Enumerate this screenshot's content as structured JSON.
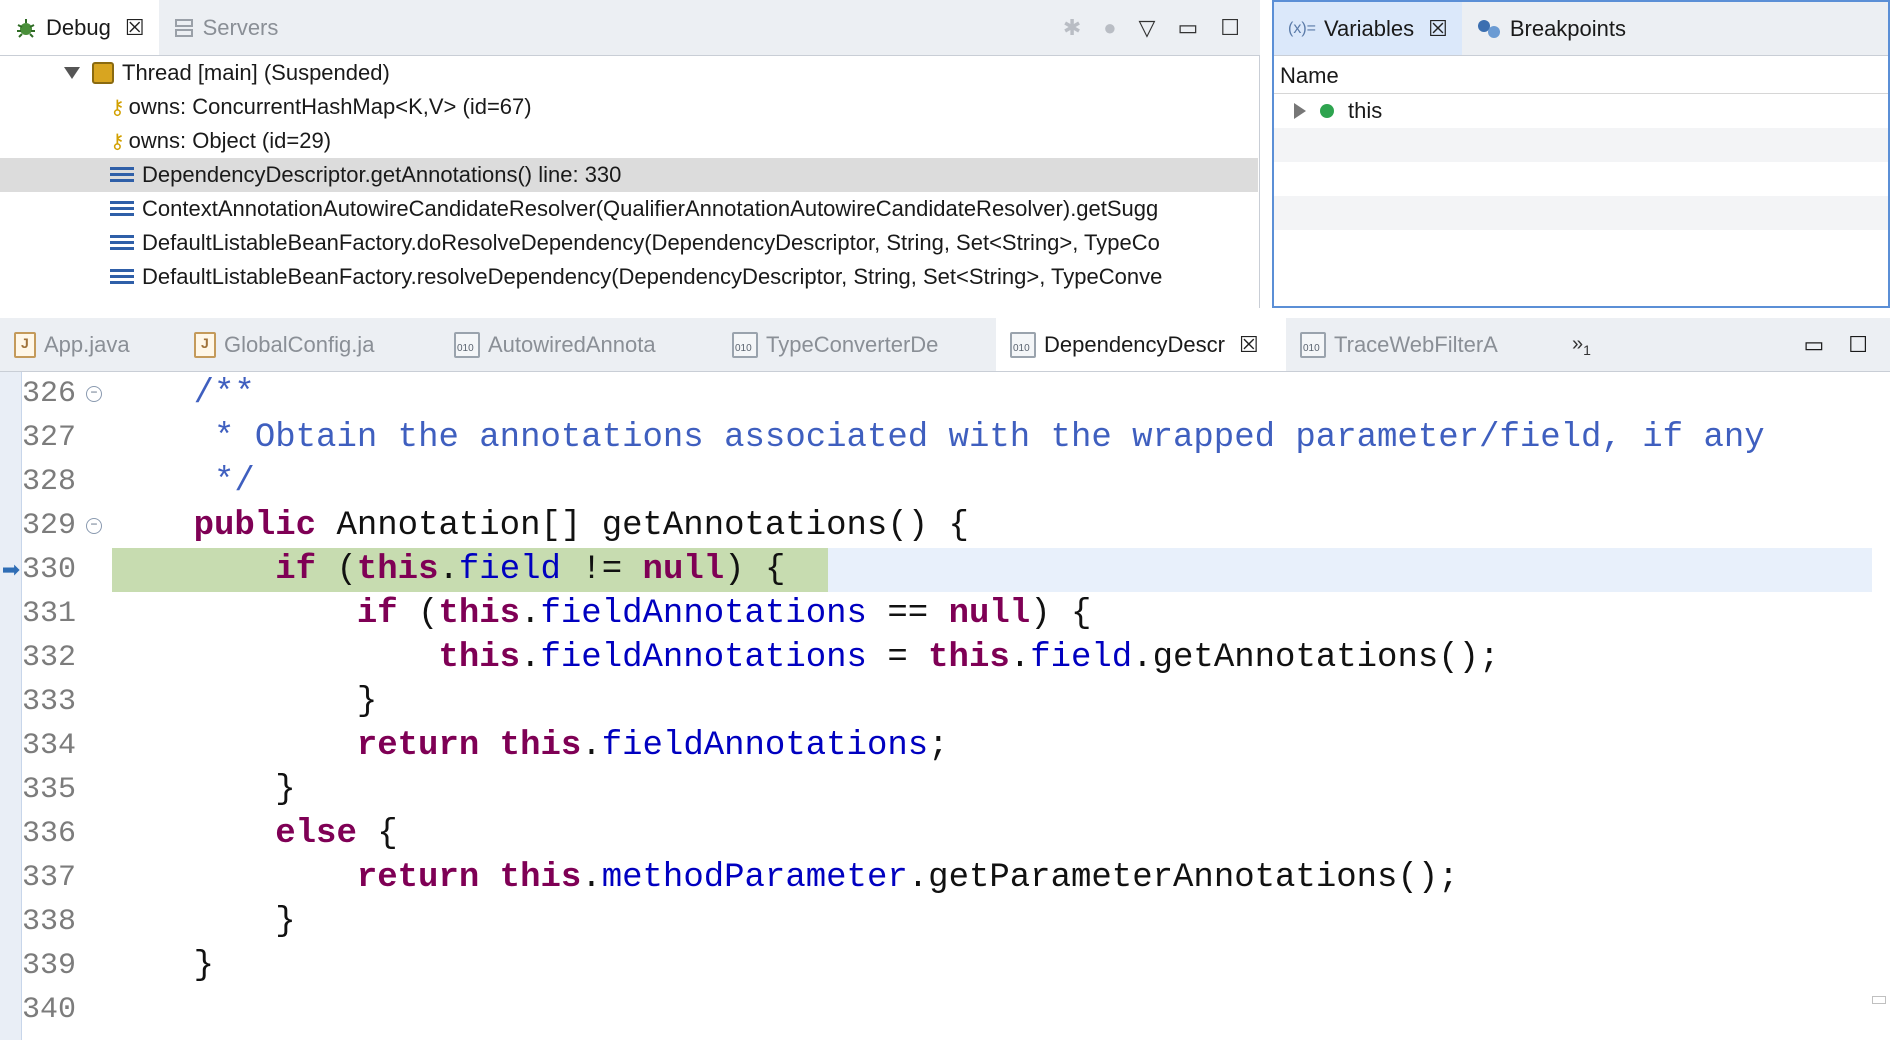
{
  "debug": {
    "tab_label": "Debug",
    "servers_label": "Servers",
    "tree": [
      {
        "kind": "thread",
        "label": "Thread [main] (Suspended)"
      },
      {
        "kind": "monitor",
        "label": "owns: ConcurrentHashMap<K,V>  (id=67)"
      },
      {
        "kind": "monitor",
        "label": "owns: Object  (id=29)"
      },
      {
        "kind": "frame",
        "label": "DependencyDescriptor.getAnnotations() line: 330",
        "selected": true
      },
      {
        "kind": "frame",
        "label": "ContextAnnotationAutowireCandidateResolver(QualifierAnnotationAutowireCandidateResolver).getSugg"
      },
      {
        "kind": "frame",
        "label": "DefaultListableBeanFactory.doResolveDependency(DependencyDescriptor, String, Set<String>, TypeCo"
      },
      {
        "kind": "frame",
        "label": "DefaultListableBeanFactory.resolveDependency(DependencyDescriptor, String, Set<String>, TypeConve"
      }
    ]
  },
  "variables": {
    "tab_label": "Variables",
    "tab_prefix": "(x)=",
    "breakpoints_label": "Breakpoints",
    "column_name": "Name",
    "rows": [
      {
        "name": "this"
      }
    ]
  },
  "editor": {
    "tabs": [
      {
        "label": "App.java",
        "type": "java",
        "active": false
      },
      {
        "label": "GlobalConfig.ja",
        "type": "java",
        "active": false
      },
      {
        "label": "AutowiredAnnota",
        "type": "class",
        "active": false
      },
      {
        "label": "TypeConverterDe",
        "type": "class",
        "active": false
      },
      {
        "label": "DependencyDescr",
        "type": "class",
        "active": true
      },
      {
        "label": "TraceWebFilterA",
        "type": "class",
        "active": false
      }
    ],
    "more_tabs_glyph": "»",
    "more_tabs_count": "1",
    "line_numbers": [
      "326",
      "327",
      "328",
      "329",
      "330",
      "331",
      "332",
      "333",
      "334",
      "335",
      "336",
      "337",
      "338",
      "339",
      "340"
    ],
    "current_line": "330",
    "code": {
      "l326": "/**",
      "l327": "* Obtain the annotations associated with the wrapped parameter/field, if any",
      "l328": "*/",
      "kw_public": "public",
      "l329_rest": " Annotation[] getAnnotations() {",
      "kw_if": "if",
      "kw_this": "this",
      "kw_null": "null",
      "kw_return": "return",
      "kw_else": "else",
      "fld_field": "field",
      "fld_fieldAnnotations": "fieldAnnotations",
      "fld_methodParameter": "methodParameter",
      "p_open": " (",
      "p_dot": ".",
      "p_neq": " != ",
      "p_eq2": " == ",
      "p_assign": " = ",
      "p_close_brace": ") {",
      "p_get_annotations": ".getAnnotations();",
      "p_brace_close": "}",
      "p_semicolon": ";",
      "p_space": " ",
      "p_else_brace": " {",
      "p_get_param_annotations": ".getParameterAnnotations();"
    }
  }
}
